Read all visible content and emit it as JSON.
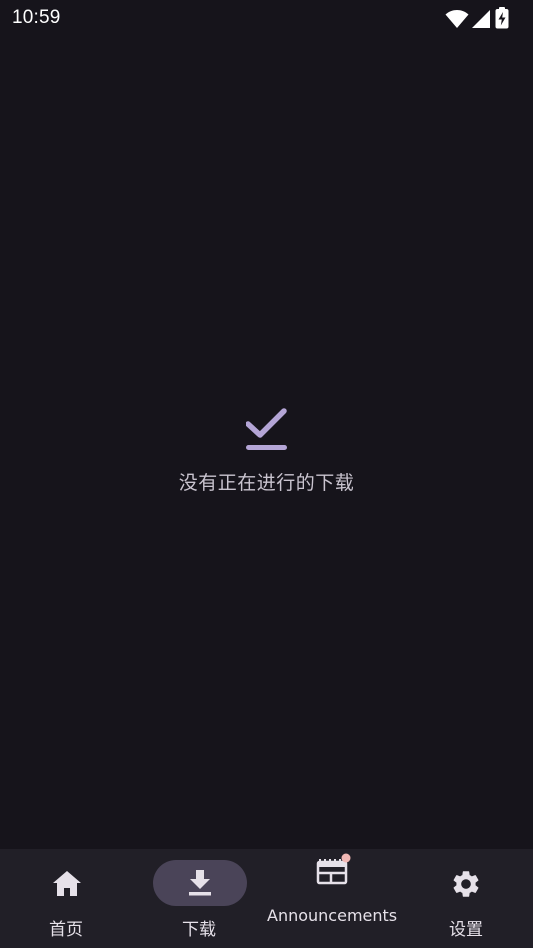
{
  "status_bar": {
    "time": "10:59",
    "icons": [
      "wifi-icon",
      "cellular-signal-icon",
      "battery-charging-icon"
    ]
  },
  "empty_state": {
    "icon": "check-icon",
    "message": "没有正在进行的下载"
  },
  "bottom_nav": {
    "items": [
      {
        "label": "首页",
        "icon": "home-icon",
        "selected": false
      },
      {
        "label": "下载",
        "icon": "download-icon",
        "selected": true
      },
      {
        "label": "Announcements",
        "icon": "newspaper-icon",
        "selected": false,
        "has_badge": true
      },
      {
        "label": "设置",
        "icon": "gear-icon",
        "selected": false
      }
    ]
  },
  "colors": {
    "background": "#16141b",
    "nav_background": "#211f27",
    "selected_pill": "#4a4458",
    "accent": "#b4a5d6",
    "badge": "#f2b8b5"
  }
}
